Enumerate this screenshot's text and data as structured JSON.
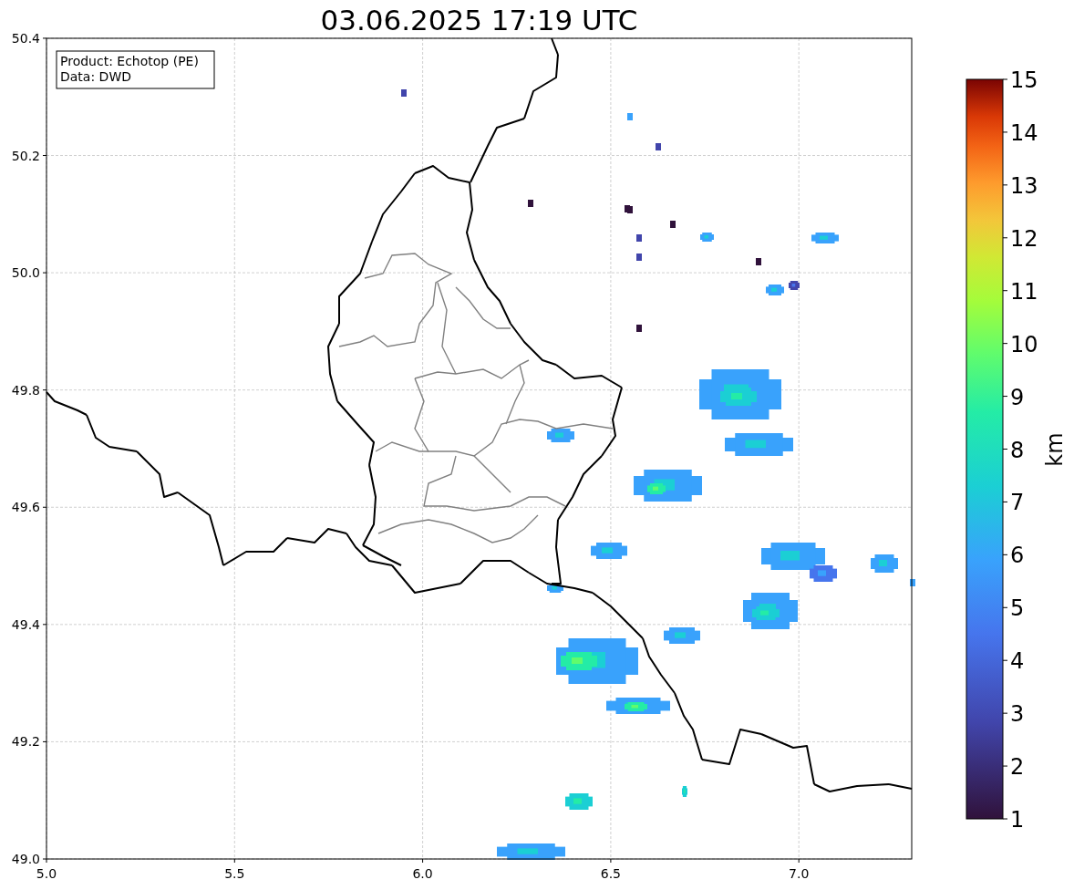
{
  "title": "03.06.2025 17:19 UTC",
  "legend": [
    "Product: Echotop (PE)",
    "Data: DWD"
  ],
  "x_ticks": [
    "5.0",
    "5.5",
    "6.0",
    "6.5",
    "7.0"
  ],
  "y_ticks": [
    "50.4",
    "50.2",
    "50.0",
    "49.8",
    "49.6",
    "49.4",
    "49.2",
    "49.0"
  ],
  "colorbar": {
    "label": "km",
    "ticks": [
      "15",
      "14",
      "13",
      "12",
      "11",
      "10",
      "9",
      "8",
      "7",
      "6",
      "5",
      "4",
      "3",
      "2",
      "1"
    ]
  }
}
